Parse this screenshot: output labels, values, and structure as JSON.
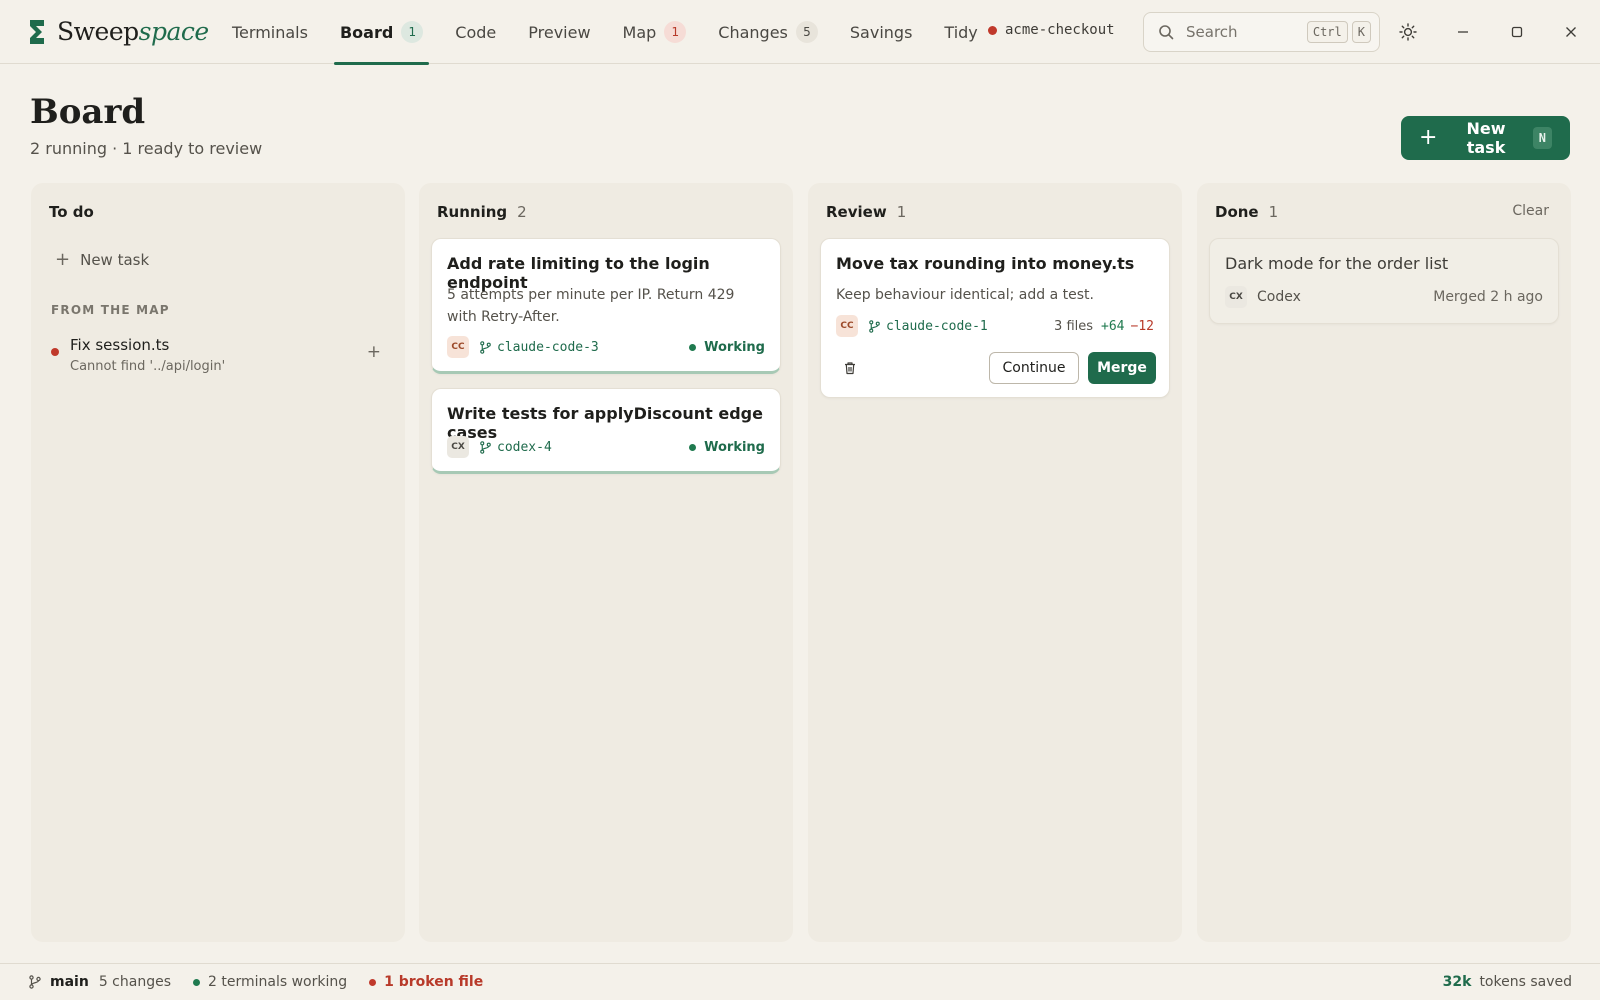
{
  "app": {
    "brand_primary": "Sweep",
    "brand_secondary": "space",
    "accent_color": "#1f6b4c"
  },
  "nav": {
    "tabs": [
      {
        "label": "Terminals",
        "badge": null
      },
      {
        "label": "Board",
        "badge": "1",
        "active": true
      },
      {
        "label": "Code",
        "badge": null
      },
      {
        "label": "Preview",
        "badge": null
      },
      {
        "label": "Map",
        "badge": "1"
      },
      {
        "label": "Changes",
        "badge": "5"
      },
      {
        "label": "Savings",
        "badge": null
      },
      {
        "label": "Tidy",
        "badge": null
      }
    ]
  },
  "repo": {
    "name": "acme-checkout",
    "status_color": "#c0392b"
  },
  "search": {
    "placeholder": "Search",
    "shortcut_mod": "Ctrl",
    "shortcut_key": "K"
  },
  "window_controls": {
    "theme_icon": "sun-icon",
    "minimize_icon": "minimize-icon",
    "maximize_icon": "maximize-icon",
    "close_icon": "close-icon"
  },
  "header": {
    "title": "Board",
    "subtitle": "2 running · 1 ready to review",
    "new_task_label": "New task",
    "new_task_shortcut": "N"
  },
  "columns": {
    "todo": {
      "title": "To do",
      "new_task_label": "New task",
      "section_label": "FROM THE MAP",
      "map_items": [
        {
          "title": "Fix session.ts",
          "subtitle": "Cannot find '../api/login'"
        }
      ]
    },
    "running": {
      "title": "Running",
      "count": "2",
      "cards": [
        {
          "title": "Add rate limiting to the login endpoint",
          "description": "5 attempts per minute per IP. Return 429 with Retry-After.",
          "agent": "CC",
          "branch": "claude-code-3",
          "status": "Working"
        },
        {
          "title": "Write tests for applyDiscount edge cases",
          "description": "",
          "agent": "CX",
          "branch": "codex-4",
          "status": "Working"
        }
      ]
    },
    "review": {
      "title": "Review",
      "count": "1",
      "cards": [
        {
          "title": "Move tax rounding into money.ts",
          "description": "Keep behaviour identical; add a test.",
          "agent": "CC",
          "branch": "claude-code-1",
          "files": "3 files",
          "additions": "+64",
          "deletions": "−12",
          "continue_label": "Continue",
          "merge_label": "Merge"
        }
      ]
    },
    "done": {
      "title": "Done",
      "count": "1",
      "clear_label": "Clear",
      "cards": [
        {
          "title": "Dark mode for the order list",
          "agent": "CX",
          "agent_name": "Codex",
          "merged": "Merged 2 h ago"
        }
      ]
    }
  },
  "statusbar": {
    "branch": "main",
    "changes": "5 changes",
    "terminals": "2 terminals working",
    "broken": "1 broken file",
    "tokens_value": "32k",
    "tokens_label": "tokens saved"
  }
}
